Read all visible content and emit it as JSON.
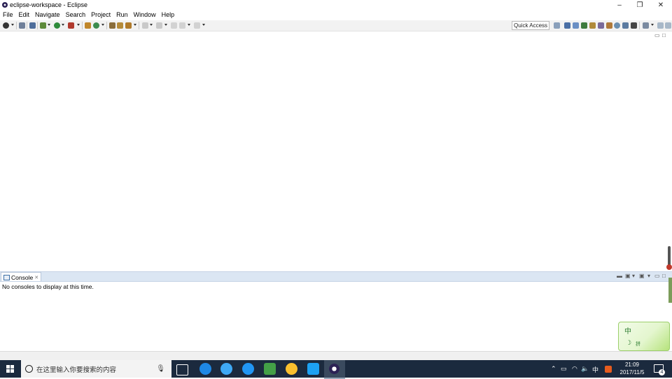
{
  "window": {
    "title": "eclipse-workspace - Eclipse",
    "controls": {
      "minimize": "–",
      "restore": "❐",
      "close": "✕"
    }
  },
  "menu": [
    "File",
    "Edit",
    "Navigate",
    "Search",
    "Project",
    "Run",
    "Window",
    "Help"
  ],
  "toolbar": {
    "quick_access_label": "Quick Access"
  },
  "console": {
    "tab_label": "Console",
    "tab_close": "✕",
    "message": "No consoles to display at this time."
  },
  "taskbar": {
    "search_placeholder": "在这里输入你要搜索的内容",
    "ime_indicator": "中",
    "clock_time": "21:09",
    "clock_date": "2017/11/5",
    "notification_count": "4"
  },
  "ime_widget": {
    "label": "中",
    "sub": "拼"
  },
  "colors": {
    "taskbar": "#1b2a3e",
    "toolbar": "#f2f2f2",
    "view_tabbar": "#dbe6f3"
  }
}
